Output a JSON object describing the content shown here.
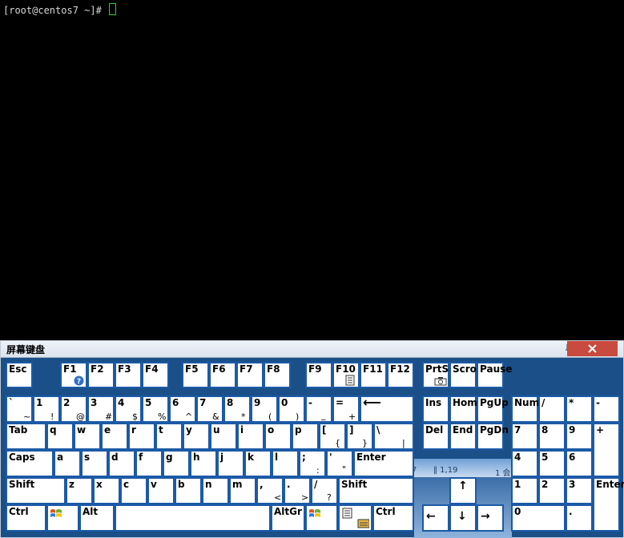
{
  "terminal": {
    "prompt": "[root@centos7 ~]# "
  },
  "osk": {
    "title": "屏幕键盘",
    "buttons": {
      "pin_icon": "pin-icon",
      "close_icon": "close-icon"
    },
    "colors": {
      "frame": "#1a4f88",
      "key_border": "#1c5aa6",
      "key_bg": "#ffffff",
      "close": "#c94a3e"
    },
    "status": {
      "left": "7",
      "mid": "‖ 1,19",
      "right": "1 会"
    },
    "keys": {
      "esc": "Esc",
      "f1": "F1",
      "f2": "F2",
      "f3": "F3",
      "f4": "F4",
      "f5": "F5",
      "f6": "F6",
      "f7": "F7",
      "f8": "F8",
      "f9": "F9",
      "f10": "F10",
      "f11": "F11",
      "f12": "F12",
      "prtsc": "PrtSc",
      "scroll": "Scrol",
      "pause": "Pause",
      "backtick": "`",
      "backtick_s": "~",
      "n1": "1",
      "n1_s": "!",
      "n2": "2",
      "n2_s": "@",
      "n3": "3",
      "n3_s": "#",
      "n4": "4",
      "n4_s": "$",
      "n5": "5",
      "n5_s": "%",
      "n6": "6",
      "n6_s": "^",
      "n7": "7",
      "n7_s": "&",
      "n8": "8",
      "n8_s": "*",
      "n9": "9",
      "n9_s": "(",
      "n0": "0",
      "n0_s": ")",
      "minus": "-",
      "minus_s": "_",
      "equal": "=",
      "equal_s": "+",
      "backspace": "⟵",
      "ins": "Ins",
      "home": "Home",
      "pgup": "PgUp",
      "numlk": "NumL",
      "np_div": "/",
      "np_mul": "*",
      "np_sub": "-",
      "tab": "Tab",
      "q": "q",
      "w": "w",
      "e": "e",
      "r": "r",
      "t": "t",
      "y": "y",
      "u": "u",
      "i": "i",
      "o": "o",
      "p": "p",
      "lbr": "[",
      "lbr_s": "{",
      "rbr": "]",
      "rbr_s": "}",
      "bslash": "\\",
      "bslash_s": "|",
      "del": "Del",
      "end": "End",
      "pgdn": "PgDn",
      "np7": "7",
      "np8": "8",
      "np9": "9",
      "np_add": "+",
      "caps": "Caps",
      "a": "a",
      "s": "s",
      "d": "d",
      "f": "f",
      "g": "g",
      "h": "h",
      "j": "j",
      "k": "k",
      "l": "l",
      "semi": ";",
      "semi_s": ":",
      "quote": "'",
      "quote_s": "\"",
      "enter": "Enter",
      "np4": "4",
      "np5": "5",
      "np6": "6",
      "lshift": "Shift",
      "z": "z",
      "x": "x",
      "c": "c",
      "v": "v",
      "b": "b",
      "n": "n",
      "m": "m",
      "comma": ",",
      "comma_s": "<",
      "period": ".",
      "period_s": ">",
      "slash": "/",
      "slash_s": "?",
      "rshift": "Shift",
      "up": "↑",
      "np1": "1",
      "np2": "2",
      "np3": "3",
      "np_enter": "Enter",
      "lctrl": "Ctrl",
      "alt": "Alt",
      "altgr": "AltGr",
      "rctrl": "Ctrl",
      "left": "←",
      "down": "↓",
      "right": "→",
      "np0": "0",
      "np_dot": "."
    }
  }
}
